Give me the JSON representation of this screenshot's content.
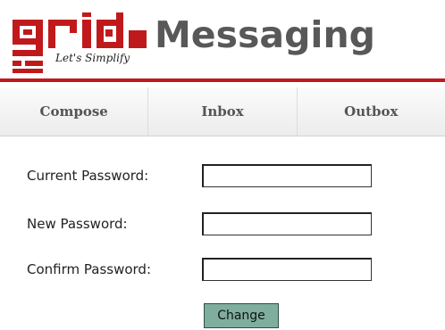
{
  "header": {
    "logo_text": "grid",
    "logo_tagline": "Let's Simplify",
    "app_title": "Messaging"
  },
  "nav": {
    "tabs": [
      {
        "label": "Compose"
      },
      {
        "label": "Inbox"
      },
      {
        "label": "Outbox"
      }
    ]
  },
  "form": {
    "fields": [
      {
        "label": "Current Password:",
        "value": ""
      },
      {
        "label": "New Password:",
        "value": ""
      },
      {
        "label": "Confirm Password:",
        "value": ""
      }
    ],
    "submit_label": "Change"
  },
  "colors": {
    "brand_red": "#c0191c",
    "title_gray": "#585858",
    "button_green": "#7fae9f"
  }
}
